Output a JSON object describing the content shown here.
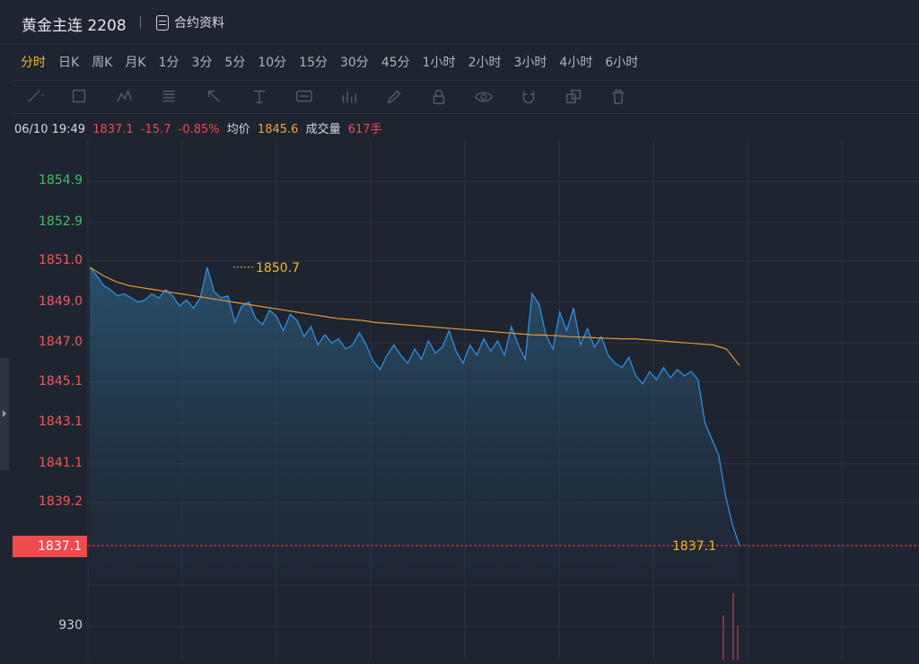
{
  "header": {
    "title": "黄金主连 2208",
    "doc_label": "合约资料"
  },
  "periods": [
    {
      "label": "分时",
      "active": true
    },
    {
      "label": "日K"
    },
    {
      "label": "周K"
    },
    {
      "label": "月K"
    },
    {
      "label": "1分"
    },
    {
      "label": "3分"
    },
    {
      "label": "5分"
    },
    {
      "label": "10分"
    },
    {
      "label": "15分"
    },
    {
      "label": "30分"
    },
    {
      "label": "45分"
    },
    {
      "label": "1小时"
    },
    {
      "label": "2小时"
    },
    {
      "label": "3小时"
    },
    {
      "label": "4小时"
    },
    {
      "label": "6小时"
    }
  ],
  "tools": [
    "line-tool-icon",
    "rect-tool-icon",
    "pattern-tool-icon",
    "fib-tool-icon",
    "arrow-tool-icon",
    "text-tool-icon",
    "label-tool-icon",
    "measure-tool-icon",
    "pen-icon",
    "lock-icon",
    "eye-icon",
    "magnet-icon",
    "copy-icon",
    "trash-icon"
  ],
  "info": {
    "time": "06/10 19:49",
    "price": "1837.1",
    "change": "-15.7",
    "change_pct": "-0.85%",
    "avg_label": "均价",
    "avg": "1845.6",
    "vol_label": "成交量",
    "vol": "617手"
  },
  "chart_data": {
    "type": "line",
    "y_ticks": [
      {
        "label": "1854.9",
        "value": 1854.9,
        "dir": "up"
      },
      {
        "label": "1852.9",
        "value": 1852.9,
        "dir": "up"
      },
      {
        "label": "1851.0",
        "value": 1851.0,
        "dir": "neutral"
      },
      {
        "label": "1849.0",
        "value": 1849.0,
        "dir": "down"
      },
      {
        "label": "1847.0",
        "value": 1847.0,
        "dir": "down"
      },
      {
        "label": "1845.1",
        "value": 1845.1,
        "dir": "down"
      },
      {
        "label": "1843.1",
        "value": 1843.1,
        "dir": "down"
      },
      {
        "label": "1841.1",
        "value": 1841.1,
        "dir": "down"
      },
      {
        "label": "1839.2",
        "value": 1839.2,
        "dir": "down"
      }
    ],
    "vol_tick": {
      "label": "930",
      "value": 930
    },
    "ylim": [
      1836,
      1856.5
    ],
    "max_marker": {
      "label": "1850.7",
      "value": 1850.7
    },
    "last_price": {
      "label": "1837.1",
      "value": 1837.1
    },
    "price_series": [
      1850.7,
      1850.3,
      1849.8,
      1849.6,
      1849.3,
      1849.4,
      1849.2,
      1849.0,
      1849.1,
      1849.4,
      1849.2,
      1849.6,
      1849.3,
      1848.8,
      1849.1,
      1848.7,
      1849.2,
      1850.7,
      1849.5,
      1849.2,
      1849.3,
      1848.0,
      1848.8,
      1849.0,
      1848.2,
      1847.9,
      1848.6,
      1848.3,
      1847.6,
      1848.4,
      1848.1,
      1847.3,
      1847.8,
      1846.9,
      1847.4,
      1847.0,
      1847.2,
      1846.7,
      1846.9,
      1847.5,
      1846.9,
      1846.1,
      1845.7,
      1846.4,
      1846.9,
      1846.4,
      1846.0,
      1846.7,
      1846.2,
      1847.1,
      1846.5,
      1846.8,
      1847.6,
      1846.6,
      1846.0,
      1846.9,
      1846.4,
      1847.2,
      1846.6,
      1847.1,
      1846.4,
      1847.8,
      1846.9,
      1846.2,
      1849.4,
      1848.9,
      1847.4,
      1846.7,
      1848.5,
      1847.6,
      1848.7,
      1846.9,
      1847.7,
      1846.8,
      1847.3,
      1846.4,
      1846.0,
      1845.8,
      1846.3,
      1845.4,
      1845.0,
      1845.6,
      1845.2,
      1845.8,
      1845.3,
      1845.7,
      1845.4,
      1845.6,
      1845.2,
      1843.1,
      1842.3,
      1841.5,
      1839.5,
      1838.1,
      1837.1
    ],
    "avg_series": [
      1850.7,
      1850.3,
      1850.0,
      1849.8,
      1849.7,
      1849.6,
      1849.5,
      1849.4,
      1849.3,
      1849.2,
      1849.1,
      1849.0,
      1848.9,
      1848.8,
      1848.7,
      1848.6,
      1848.5,
      1848.4,
      1848.3,
      1848.2,
      1848.15,
      1848.1,
      1848.0,
      1847.95,
      1847.9,
      1847.85,
      1847.8,
      1847.75,
      1847.7,
      1847.65,
      1847.6,
      1847.55,
      1847.5,
      1847.45,
      1847.4,
      1847.38,
      1847.35,
      1847.3,
      1847.28,
      1847.25,
      1847.22,
      1847.2,
      1847.2,
      1847.15,
      1847.1,
      1847.05,
      1847.0,
      1846.95,
      1846.9,
      1846.7,
      1845.9
    ],
    "volume_bars": [
      0,
      0,
      620,
      930,
      480
    ]
  }
}
